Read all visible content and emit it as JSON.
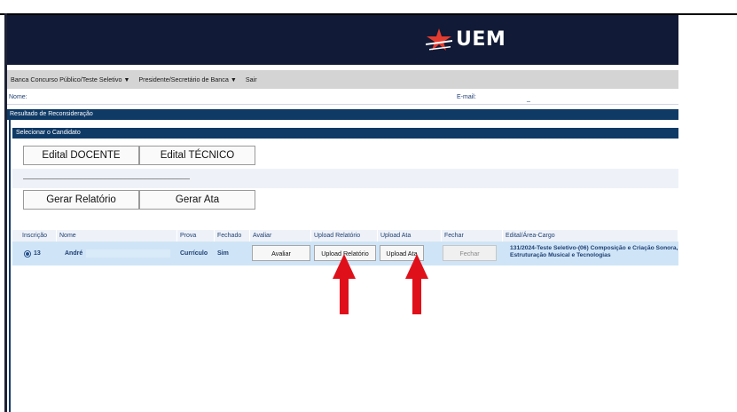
{
  "brand": {
    "logo_text": "UEM"
  },
  "menu": {
    "items": [
      {
        "label": "Banca Concurso Público/Teste Seletivo",
        "has_caret": true
      },
      {
        "label": "Presidente/Secretário de Banca",
        "has_caret": true
      },
      {
        "label": "Sair",
        "has_caret": false
      }
    ],
    "caret": "▼"
  },
  "user": {
    "name_label": "Nome:",
    "email_label": "E-mail:",
    "email_value": "_"
  },
  "section_title": "Resultado de Reconsideração",
  "panel_title": "Selecionar o Candidato",
  "buttons": {
    "edital_docente": "Edital DOCENTE",
    "edital_tecnico": "Edital TÉCNICO",
    "gerar_relatorio": "Gerar Relatório",
    "gerar_ata": "Gerar Ata"
  },
  "table": {
    "headers": [
      "Inscrição",
      "Nome",
      "Prova",
      "Fechado",
      "Avaliar",
      "Upload Relatório",
      "Upload Ata",
      "Fechar",
      "Edital/Área-Cargo"
    ],
    "rows": [
      {
        "selected": true,
        "inscricao": "13",
        "nome": "André",
        "prova": "Currículo",
        "fechado": "Sim",
        "avaliar": "Avaliar",
        "upload_relatorio": "Upload Relatório",
        "upload_ata": "Upload Ata",
        "fechar": "Fechar",
        "edital": "131/2024-Teste Seletivo-(06) Composição e Criação Sonora, Estruturação Musical e Tecnologias"
      }
    ]
  },
  "colors": {
    "banner": "#111a36",
    "section": "#0f3a66",
    "row_selected": "#cfe5f7",
    "arrow": "#e0101a"
  },
  "annotations": {
    "arrows": [
      "arrow-up-icon",
      "arrow-up-icon"
    ]
  }
}
